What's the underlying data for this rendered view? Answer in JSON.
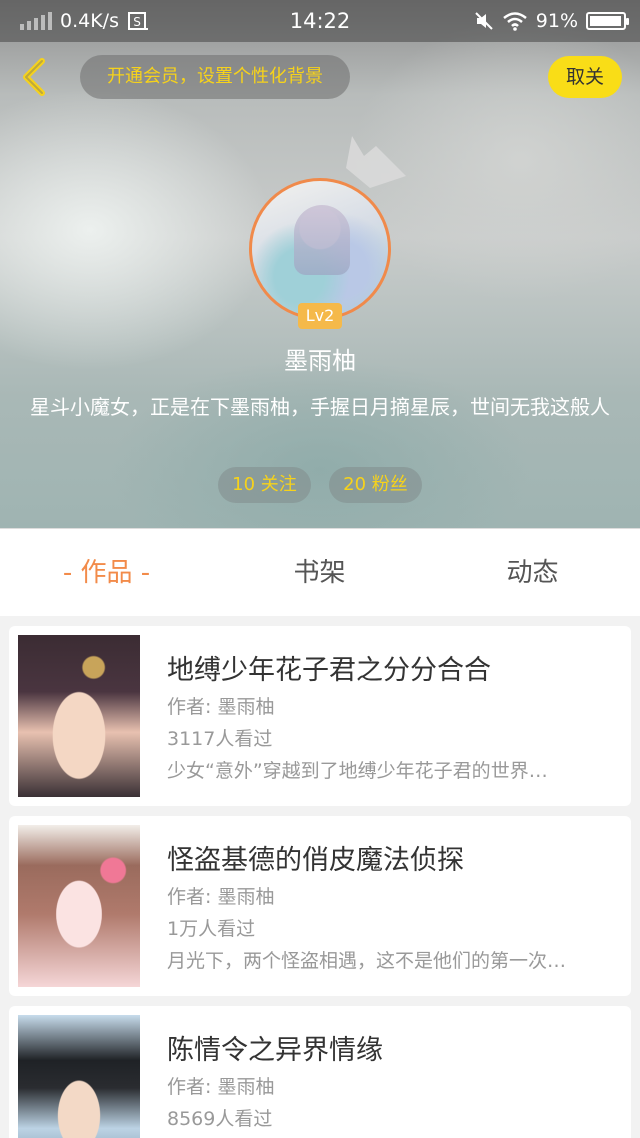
{
  "statusbar": {
    "network_speed": "0.4K/s",
    "time": "14:22",
    "battery_percent": "91%",
    "battery_level": 0.91
  },
  "header": {
    "vip_prompt": "开通会员，设置个性化背景",
    "unfollow_label": "取关",
    "level": "Lv2",
    "username": "墨雨柚",
    "bio": "星斗小魔女，正是在下墨雨柚，手握日月摘星辰，世间无我这般人",
    "following": "10 关注",
    "fans": "20 粉丝"
  },
  "tabs": [
    {
      "label": "- 作品 -",
      "active": true
    },
    {
      "label": "书架",
      "active": false
    },
    {
      "label": "动态",
      "active": false
    }
  ],
  "books": [
    {
      "title": "地缚少年花子君之分分合合",
      "author": "作者: 墨雨柚",
      "views": "3117人看过",
      "desc": "少女“意外”穿越到了地缚少年花子君的世界…"
    },
    {
      "title": "怪盗基德的俏皮魔法侦探",
      "author": "作者: 墨雨柚",
      "views": "1万人看过",
      "desc": "月光下，两个怪盗相遇，这不是他们的第一次…"
    },
    {
      "title": "陈情令之异界情缘",
      "author": "作者: 墨雨柚",
      "views": "8569人看过",
      "desc": ""
    }
  ],
  "colors": {
    "accent_orange": "#f28b4a",
    "accent_yellow": "#f9dd17",
    "vip_text": "#f6d21b"
  }
}
